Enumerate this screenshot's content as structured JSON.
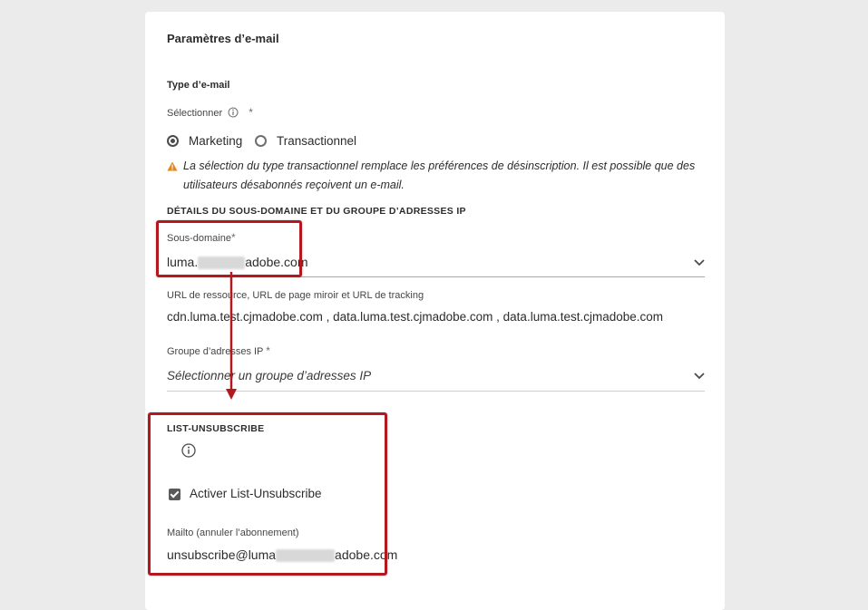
{
  "panel": {
    "title": "Paramètres d’e-mail"
  },
  "email_type": {
    "section_label": "Type d’e-mail",
    "select_label": "Sélectionner",
    "required_mark": "*",
    "options": [
      {
        "label": "Marketing",
        "checked": true
      },
      {
        "label": "Transactionnel",
        "checked": false
      }
    ],
    "warning_line1": "La sélection du type transactionnel remplace les préférences de désinscription. Il est possible que des",
    "warning_line2": "utilisateurs désabonnés reçoivent un e-mail."
  },
  "subdomain_section": {
    "title": "DÉTAILS DU SOUS-DOMAINE ET DU GROUPE D’ADRESSES IP",
    "subdomain_label": "Sous-domaine",
    "subdomain_prefix": "luma.",
    "subdomain_suffix": "adobe.com",
    "urls_label": "URL de ressource, URL de page miroir et URL de tracking",
    "urls_value": "cdn.luma.test.cjmadobe.com , data.luma.test.cjmadobe.com , data.luma.test.cjmadobe.com",
    "ip_pool_label": "Groupe d’adresses IP",
    "ip_pool_placeholder": "Sélectionner un groupe d’adresses IP"
  },
  "list_unsubscribe": {
    "title": "LIST-UNSUBSCRIBE",
    "checkbox_label": "Activer List-Unsubscribe",
    "checkbox_checked": true,
    "mailto_label": "Mailto (annuler l’abonnement)",
    "mailto_prefix": "unsubscribe@luma",
    "mailto_suffix": "adobe.com"
  },
  "colors": {
    "callout": "#b2181e",
    "warning": "#e68619"
  },
  "icons": [
    "info-icon",
    "warning-icon",
    "chevron-down-icon",
    "checkmark-icon",
    "arrow-down-icon"
  ]
}
